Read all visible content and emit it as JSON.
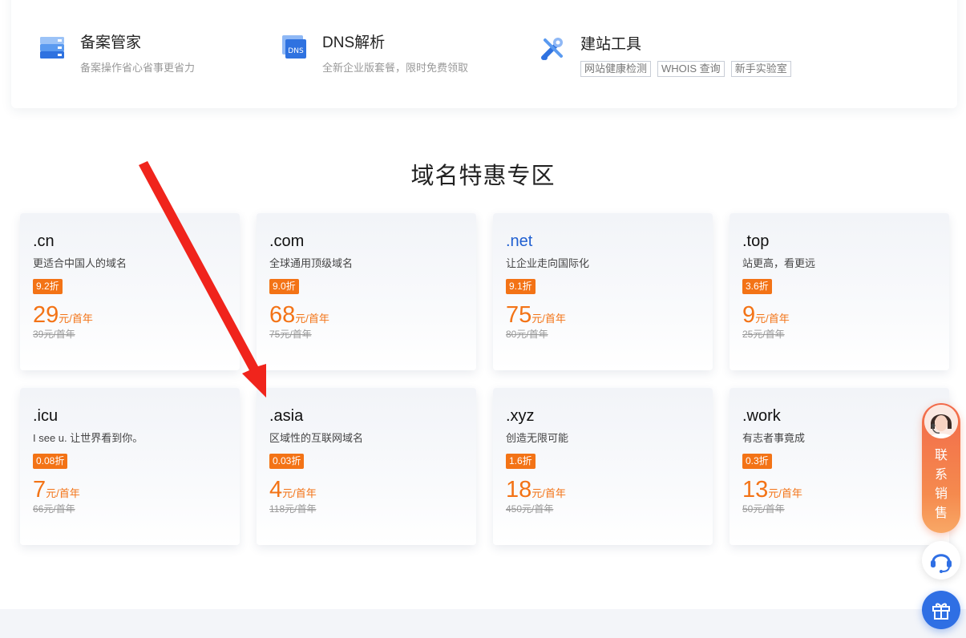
{
  "services": [
    {
      "name": "beian",
      "title": "备案管家",
      "desc": "备案操作省心省事更省力",
      "tags": []
    },
    {
      "name": "dns",
      "title": "DNS解析",
      "desc": "全新企业版套餐，限时免费领取",
      "tags": []
    },
    {
      "name": "site-tools",
      "title": "建站工具",
      "desc": "",
      "tags": [
        "网站健康检测",
        "WHOIS 查询",
        "新手实验室"
      ]
    }
  ],
  "section_title": "域名特惠专区",
  "cards": [
    {
      "tld": ".cn",
      "desc": "更适合中国人的域名",
      "discount": "9.2折",
      "price": "29",
      "unit": "元/首年",
      "orig": "39元/首年"
    },
    {
      "tld": ".com",
      "desc": "全球通用顶级域名",
      "discount": "9.0折",
      "price": "68",
      "unit": "元/首年",
      "orig": "75元/首年"
    },
    {
      "tld": ".net",
      "desc": "让企业走向国际化",
      "discount": "9.1折",
      "price": "75",
      "unit": "元/首年",
      "orig": "80元/首年"
    },
    {
      "tld": ".top",
      "desc": "站更高，看更远",
      "discount": "3.6折",
      "price": "9",
      "unit": "元/首年",
      "orig": "25元/首年"
    },
    {
      "tld": ".icu",
      "desc": "I see u. 让世界看到你。",
      "discount": "0.08折",
      "price": "7",
      "unit": "元/首年",
      "orig": "66元/首年"
    },
    {
      "tld": ".asia",
      "desc": "区域性的互联网域名",
      "discount": "0.03折",
      "price": "4",
      "unit": "元/首年",
      "orig": "118元/首年"
    },
    {
      "tld": ".xyz",
      "desc": "创造无限可能",
      "discount": "1.6折",
      "price": "18",
      "unit": "元/首年",
      "orig": "450元/首年"
    },
    {
      "tld": ".work",
      "desc": "有志者事竟成",
      "discount": "0.3折",
      "price": "13",
      "unit": "元/首年",
      "orig": "50元/首年"
    }
  ],
  "side": {
    "contact_chars": [
      "联",
      "系",
      "销",
      "售"
    ]
  },
  "colors": {
    "accent_orange": "#f37316",
    "tld_blue": "#1f5fd1",
    "arrow_red": "#f0241c",
    "gift_blue": "#2f6fe4"
  }
}
